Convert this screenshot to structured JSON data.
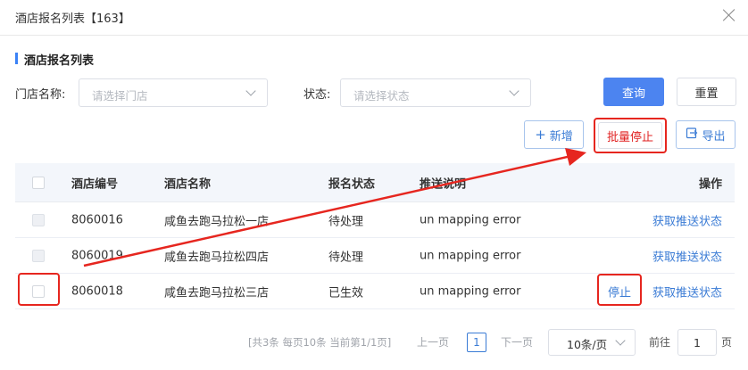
{
  "dialog": {
    "title": "酒店报名列表【163】"
  },
  "section": {
    "title": "酒店报名列表"
  },
  "filters": {
    "store_label": "门店名称:",
    "store_placeholder": "请选择门店",
    "status_label": "状态:",
    "status_placeholder": "请选择状态"
  },
  "buttons": {
    "query": "查询",
    "reset": "重置",
    "add": "新增",
    "batch_stop": "批量停止",
    "export": "导出"
  },
  "table": {
    "headers": [
      "酒店编号",
      "酒店名称",
      "报名状态",
      "推送说明",
      "操作"
    ],
    "rows": [
      {
        "id": "8060016",
        "name": "咸鱼去跑马拉松一店",
        "status": "待处理",
        "note": "un mapping error",
        "stop": "",
        "action": "获取推送状态"
      },
      {
        "id": "8060019",
        "name": "咸鱼去跑马拉松四店",
        "status": "待处理",
        "note": "un mapping error",
        "stop": "",
        "action": "获取推送状态"
      },
      {
        "id": "8060018",
        "name": "咸鱼去跑马拉松三店",
        "status": "已生效",
        "note": "un mapping error",
        "stop": "停止",
        "action": "获取推送状态"
      }
    ]
  },
  "pagination": {
    "info": "[共3条 每页10条 当前第1/1页]",
    "prev": "上一页",
    "current": "1",
    "next": "下一页",
    "page_size": "10条/页",
    "goto_label": "前往",
    "goto_value": "1",
    "page_suffix": "页"
  },
  "colors": {
    "primary": "#4c84f0",
    "link": "#3a7bd5",
    "highlight": "#e6261f"
  },
  "icons": {
    "close": "close-icon",
    "add": "plus-icon",
    "export": "export-icon",
    "dropdown": "chevron-down-icon"
  }
}
